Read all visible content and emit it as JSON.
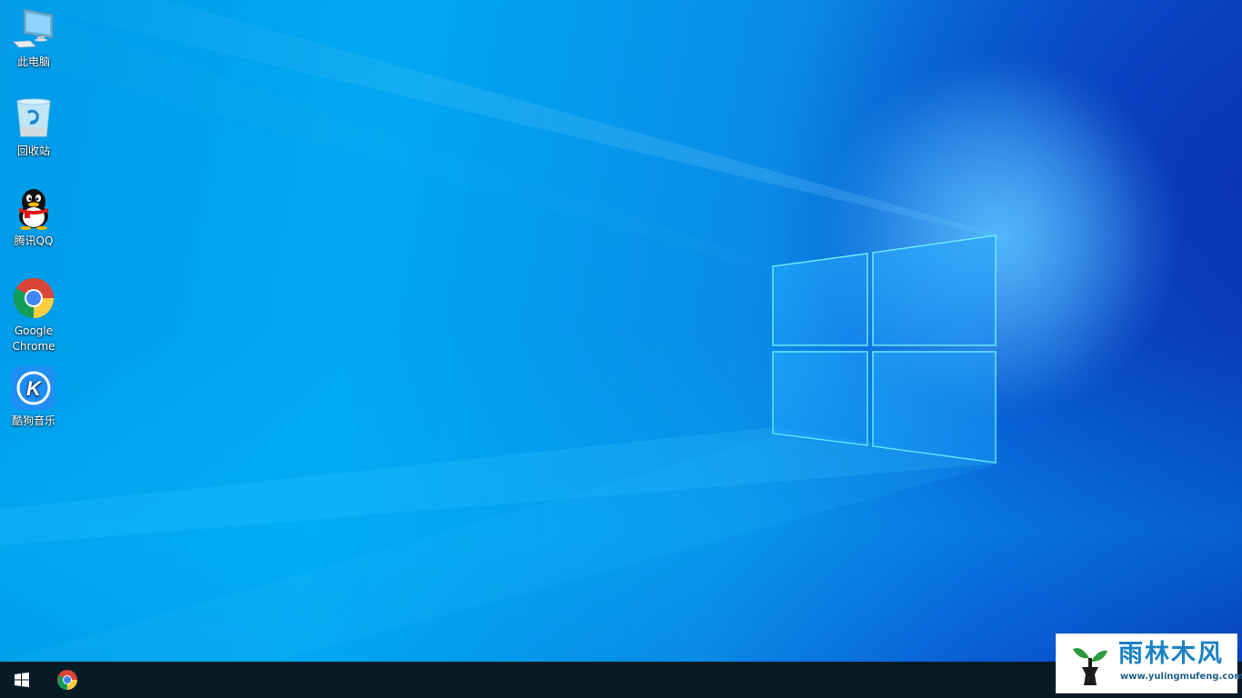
{
  "desktop": {
    "wallpaper": "windows-10-hero-blue",
    "icons": [
      {
        "label": "此电脑",
        "icon": "this-pc-icon"
      },
      {
        "label": "回收站",
        "icon": "recycle-bin-icon"
      },
      {
        "label": "腾讯QQ",
        "icon": "qq-penguin-icon"
      },
      {
        "label": "Google Chrome",
        "icon": "chrome-icon"
      },
      {
        "label": "酷狗音乐",
        "icon": "kugou-music-icon"
      }
    ]
  },
  "taskbar": {
    "start_icon": "windows-start-icon",
    "pinned_apps": [
      {
        "name": "Google Chrome",
        "icon": "chrome-icon"
      }
    ]
  },
  "watermark": {
    "title": "雨林木风",
    "url": "www.yulingmufeng.com",
    "colors": {
      "title": "#1a82c4",
      "leaf": "#2e9b3c",
      "trunk": "#1c1c1c"
    }
  }
}
